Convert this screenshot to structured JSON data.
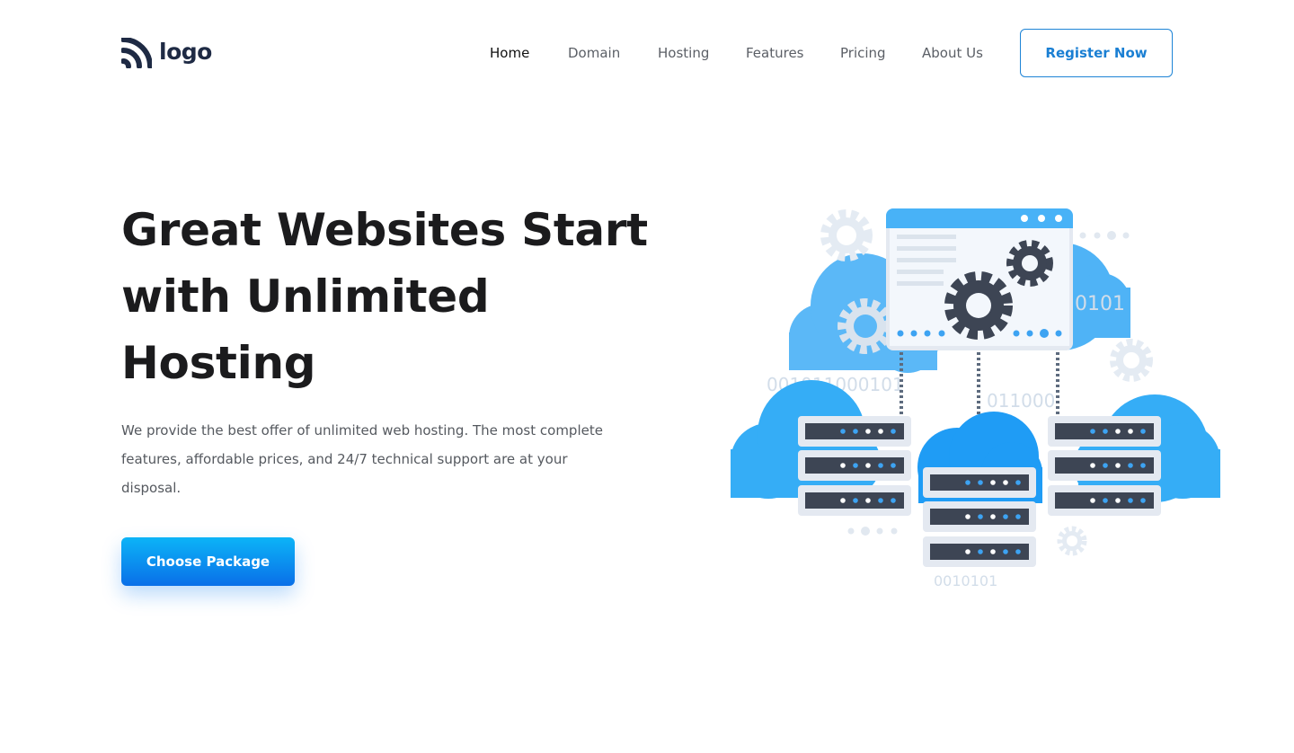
{
  "logo": {
    "text": "logo",
    "icon": "logo-arcs-icon",
    "color": "#1e2a44"
  },
  "nav": {
    "items": [
      {
        "label": "Home",
        "active": true
      },
      {
        "label": "Domain",
        "active": false
      },
      {
        "label": "Hosting",
        "active": false
      },
      {
        "label": "Features",
        "active": false
      },
      {
        "label": "Pricing",
        "active": false
      },
      {
        "label": "About Us",
        "active": false
      }
    ],
    "register_label": "Register Now"
  },
  "hero": {
    "title": "Great Websites Start with Unlimited Hosting",
    "description": "We provide the best offer of unlimited web hosting. The most complete features, affordable prices, and 24/7 technical support are at your disposal.",
    "cta_label": "Choose Package"
  },
  "illustration": {
    "binary": [
      "0101",
      "001011000101",
      "011000",
      "0010101"
    ]
  },
  "colors": {
    "accent": "#1a7fd3",
    "cta_gradient_start": "#0cb4f7",
    "cta_gradient_end": "#0a6fe8",
    "cloud": "#35adf6",
    "server_dark": "#3d4554"
  }
}
